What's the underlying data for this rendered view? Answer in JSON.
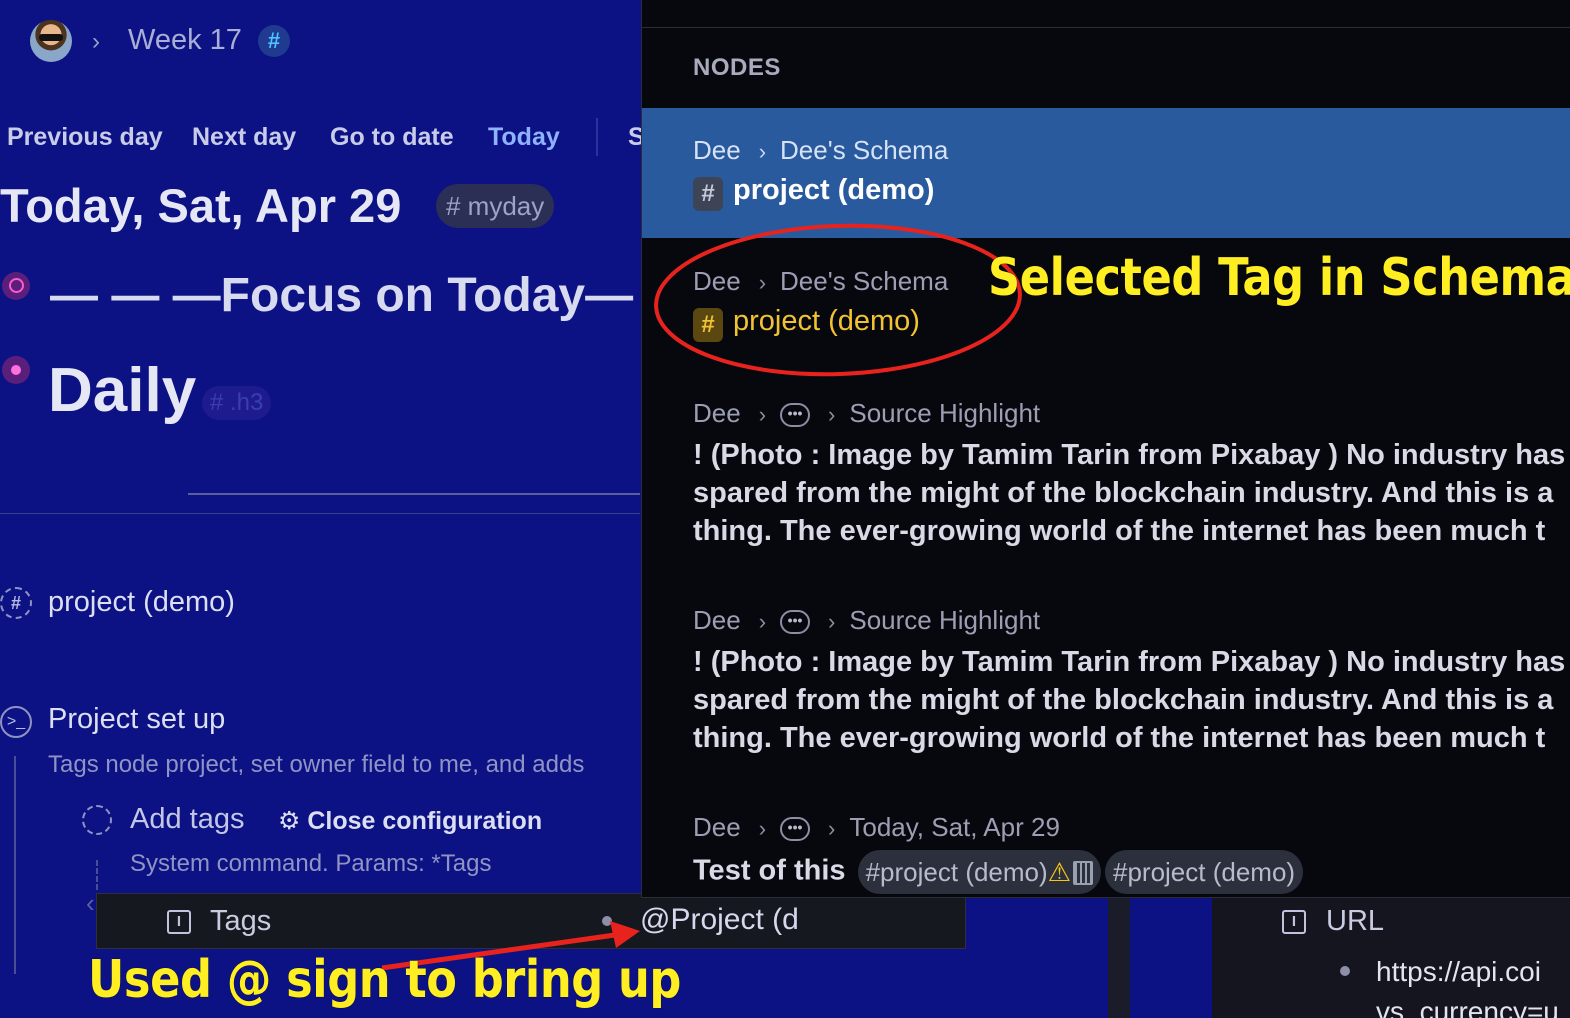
{
  "header": {
    "breadcrumb_sep": "›",
    "title": "Week 17",
    "hash_symbol": "#"
  },
  "daynav": {
    "prev": "Previous day",
    "next": "Next day",
    "goto": "Go to date",
    "today": "Today",
    "more": "S"
  },
  "page": {
    "title": "Today, Sat, Apr 29",
    "tag": "# myday",
    "focus": "— — —Focus on Today— —",
    "daily": "Daily",
    "daily_tag": "# .h3"
  },
  "outline": {
    "project_demo": "project (demo)",
    "setup_title": "Project set up",
    "setup_desc": "Tags node project, set owner field to me, and adds",
    "add_tags": "Add tags",
    "close_config": "Close configuration",
    "sys_params": "System command. Params: *Tags",
    "tags_field_label": "Tags",
    "tags_field_value": "@Project (d",
    "url_field_label": "URL",
    "url_value_1": "https://api.coi",
    "url_value_2": "vs_currency=u"
  },
  "popup": {
    "section": "NODES",
    "results": [
      {
        "crumb1": "Dee",
        "crumb2": "Dee's Schema",
        "title": "project (demo)",
        "tag_glyph": "#"
      },
      {
        "crumb1": "Dee",
        "crumb2": "Dee's Schema",
        "title": "project (demo)",
        "tag_glyph": "#"
      },
      {
        "crumb1": "Dee",
        "crumb_more": "•••",
        "crumb2": "Source Highlight",
        "line1": "! (Photo : Image by Tamim Tarin from Pixabay ) No industry has",
        "line2": "spared from the might of the blockchain industry. And this is a",
        "line3": "thing. The ever-growing world of the internet has been much t"
      },
      {
        "crumb1": "Dee",
        "crumb_more": "•••",
        "crumb2": "Source Highlight",
        "line1": "! (Photo : Image by Tamim Tarin from Pixabay ) No industry has",
        "line2": "spared from the might of the blockchain industry. And this is a",
        "line3": "thing. The ever-growing world of the internet has been much t"
      },
      {
        "crumb1": "Dee",
        "crumb_more": "•••",
        "crumb2": "Today, Sat, Apr 29",
        "title": "Test of this",
        "chip1": "#project (demo)",
        "chip1_warn": "⚠",
        "chip2": "#project (demo)"
      }
    ]
  },
  "annotations": {
    "selected_tag": "Selected Tag in Schema",
    "used_at": "Used @ sign to bring up"
  },
  "colors": {
    "annotation": "#ffee22",
    "circle": "#e8231e",
    "selected_row": "#2a5a9e",
    "tag_gold": "#f1c232"
  }
}
